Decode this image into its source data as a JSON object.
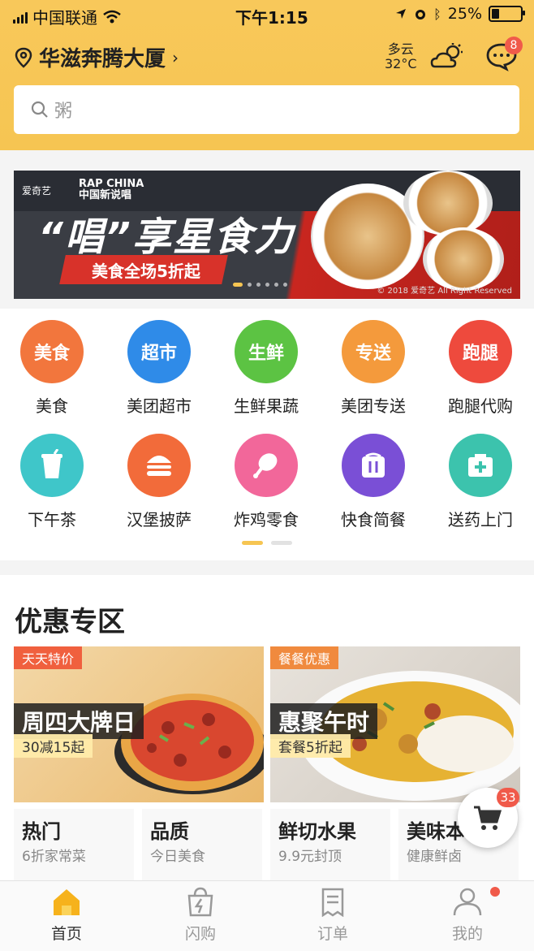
{
  "status": {
    "carrier": "中国联通",
    "time": "下午1:15",
    "battery": "25%"
  },
  "header": {
    "location": "华滋奔腾大厦",
    "weather_desc": "多云",
    "temperature": "32°C",
    "message_badge": "8"
  },
  "search": {
    "placeholder": "粥"
  },
  "banner": {
    "brand1": "爱奇艺",
    "brand2_line1": "RAP CHINA",
    "brand2_line2": "中国新说唱",
    "slogan": "“唱”享星食力",
    "subtitle": "美食全场5折起",
    "copyright": "© 2018 爱奇艺 All Right Reserved",
    "slide_count": 6,
    "active_slide": 1
  },
  "categories": [
    {
      "label": "美食",
      "icon_text": "美食",
      "icon": "food-icon",
      "color": "#f2763d"
    },
    {
      "label": "美团超市",
      "icon_text": "超市",
      "icon": "supermarket-icon",
      "color": "#2f8be8"
    },
    {
      "label": "生鲜果蔬",
      "icon_text": "生鲜",
      "icon": "fresh-produce-icon",
      "color": "#5cc343"
    },
    {
      "label": "美团专送",
      "icon_text": "专送",
      "icon": "delivery-icon",
      "color": "#f49a3c"
    },
    {
      "label": "跑腿代购",
      "icon_text": "跑腿",
      "icon": "errand-icon",
      "color": "#ee4a3d"
    },
    {
      "label": "下午茶",
      "icon_text": "",
      "icon": "drink-cup-icon",
      "color": "#3fc6c9"
    },
    {
      "label": "汉堡披萨",
      "icon_text": "",
      "icon": "burger-icon",
      "color": "#f26b3a"
    },
    {
      "label": "炸鸡零食",
      "icon_text": "",
      "icon": "chicken-leg-icon",
      "color": "#f2679a"
    },
    {
      "label": "快食简餐",
      "icon_text": "",
      "icon": "bento-icon",
      "color": "#7a4fd6"
    },
    {
      "label": "送药上门",
      "icon_text": "",
      "icon": "medicine-box-icon",
      "color": "#3cc3ad"
    }
  ],
  "category_pages": {
    "count": 2,
    "active": 1
  },
  "promo_section": {
    "title": "优惠专区",
    "cards": [
      {
        "tag": "天天特价",
        "title": "周四大牌日",
        "subtitle": "30减15起"
      },
      {
        "tag": "餐餐优惠",
        "title": "惠聚午时",
        "subtitle": "套餐5折起"
      }
    ],
    "tiles": [
      {
        "title": "热门",
        "subtitle": "6折家常菜"
      },
      {
        "title": "品质",
        "subtitle": "今日美食"
      },
      {
        "title": "鲜切水果",
        "subtitle": "9.9元封顶"
      },
      {
        "title": "美味本",
        "subtitle": "健康鲜卤"
      }
    ]
  },
  "cart": {
    "badge": "33"
  },
  "tabs": [
    {
      "label": "首页",
      "icon": "home-icon",
      "active": true
    },
    {
      "label": "闪购",
      "icon": "shopping-bag-icon",
      "active": false
    },
    {
      "label": "订单",
      "icon": "order-list-icon",
      "active": false
    },
    {
      "label": "我的",
      "icon": "user-icon",
      "active": false
    }
  ],
  "colors": {
    "accent": "#f6c552",
    "tab_active": "#f3a417",
    "tab_inactive": "#999999",
    "badge": "#f05a4a"
  }
}
